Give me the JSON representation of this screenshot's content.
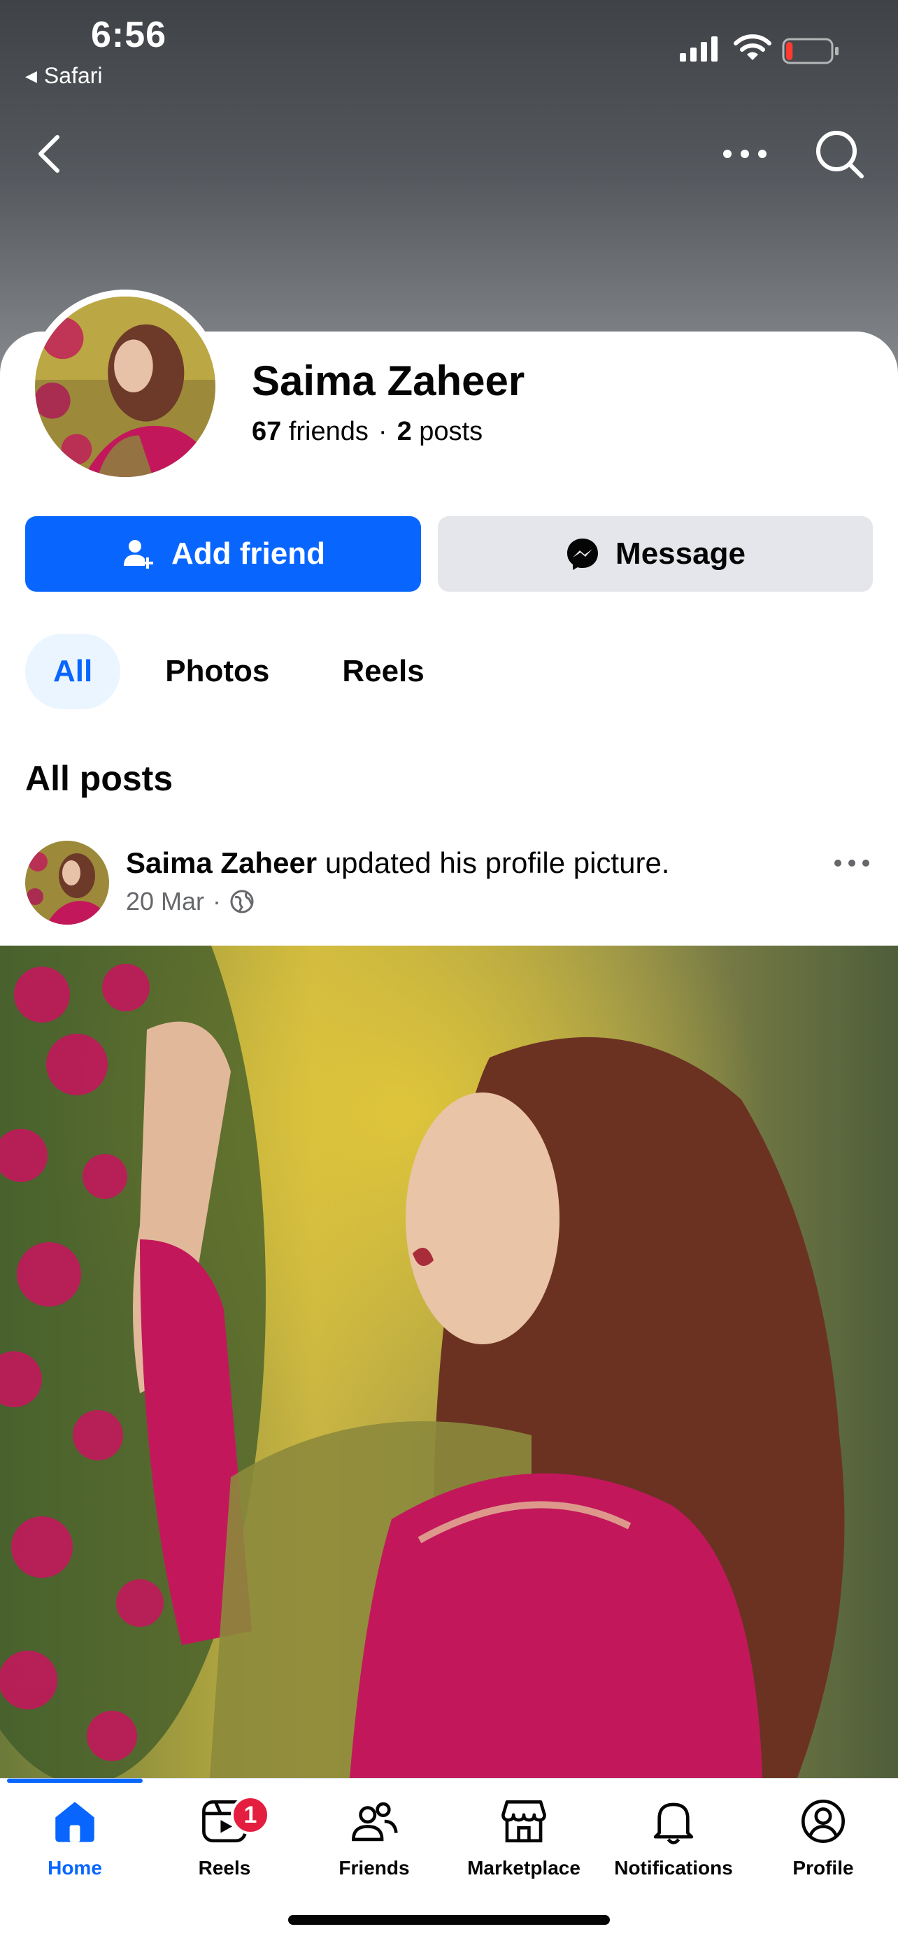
{
  "status_bar": {
    "time": "6:56",
    "back_app": "Safari",
    "battery_level": 0.15,
    "battery_color": "#ff3b30"
  },
  "nav": {
    "back_icon": "chevron-left-icon",
    "more_icon": "more-horizontal-icon",
    "search_icon": "search-icon"
  },
  "profile": {
    "name": "Saima Zaheer",
    "friends_count": "67",
    "friends_label": "friends",
    "posts_count": "2",
    "posts_label": "posts"
  },
  "actions": {
    "add_friend_label": "Add friend",
    "message_label": "Message",
    "add_friend_color": "#0866ff"
  },
  "tabs": [
    {
      "label": "All",
      "active": true
    },
    {
      "label": "Photos",
      "active": false
    },
    {
      "label": "Reels",
      "active": false
    }
  ],
  "section": {
    "title": "All posts"
  },
  "post": {
    "author": "Saima Zaheer",
    "action_text": "updated his profile picture.",
    "date": "20 Mar",
    "separator": "·",
    "audience_icon": "globe-icon"
  },
  "bottom_nav": [
    {
      "label": "Home",
      "icon": "home-icon",
      "active": true
    },
    {
      "label": "Reels",
      "icon": "reels-icon",
      "active": false,
      "badge": "1"
    },
    {
      "label": "Friends",
      "icon": "friends-icon",
      "active": false
    },
    {
      "label": "Marketplace",
      "icon": "marketplace-icon",
      "active": false
    },
    {
      "label": "Notifications",
      "icon": "bell-icon",
      "active": false
    },
    {
      "label": "Profile",
      "icon": "profile-icon",
      "active": false
    }
  ]
}
